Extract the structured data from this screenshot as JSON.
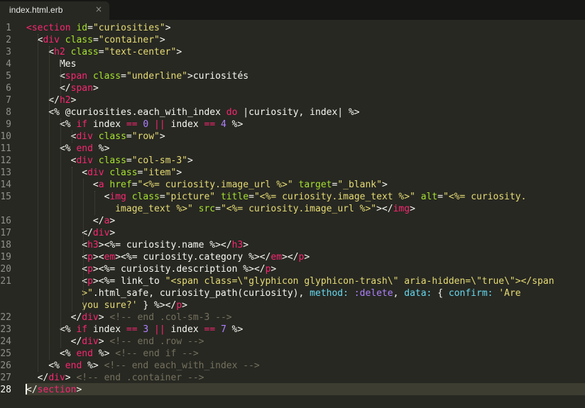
{
  "tab": {
    "title": "index.html.erb",
    "close_glyph": "×"
  },
  "editor": {
    "current_line": 28,
    "line_numbers": [
      "1",
      "2",
      "3",
      "4",
      "5",
      "6",
      "7",
      "8",
      "9",
      "10",
      "11",
      "12",
      "13",
      "14",
      "15",
      "",
      "16",
      "17",
      "18",
      "19",
      "20",
      "21",
      "",
      "",
      "22",
      "23",
      "24",
      "25",
      "26",
      "27",
      "28"
    ],
    "lines": [
      [
        [
          "t",
          "<"
        ],
        [
          "t",
          "section"
        ],
        [
          "w",
          " "
        ],
        [
          "a",
          "id"
        ],
        [
          "w",
          "="
        ],
        [
          "s",
          "\"curiosities\""
        ],
        [
          "w",
          ">"
        ]
      ],
      [
        [
          "w",
          "  <"
        ],
        [
          "t",
          "div"
        ],
        [
          "w",
          " "
        ],
        [
          "a",
          "class"
        ],
        [
          "w",
          "="
        ],
        [
          "s",
          "\"container\""
        ],
        [
          "w",
          ">"
        ]
      ],
      [
        [
          "w",
          "    <"
        ],
        [
          "t",
          "h2"
        ],
        [
          "w",
          " "
        ],
        [
          "a",
          "class"
        ],
        [
          "w",
          "="
        ],
        [
          "s",
          "\"text-center\""
        ],
        [
          "w",
          ">"
        ]
      ],
      [
        [
          "w",
          "      Mes"
        ]
      ],
      [
        [
          "w",
          "      <"
        ],
        [
          "t",
          "span"
        ],
        [
          "w",
          " "
        ],
        [
          "a",
          "class"
        ],
        [
          "w",
          "="
        ],
        [
          "s",
          "\"underline\""
        ],
        [
          "w",
          ">curiosités"
        ]
      ],
      [
        [
          "w",
          "      </"
        ],
        [
          "t",
          "span"
        ],
        [
          "w",
          ">"
        ]
      ],
      [
        [
          "w",
          "    </"
        ],
        [
          "t",
          "h2"
        ],
        [
          "w",
          ">"
        ]
      ],
      [
        [
          "w",
          "    <% @curiosities.each_with_index "
        ],
        [
          "t",
          "do"
        ],
        [
          "w",
          " |curiosity, index| %>"
        ]
      ],
      [
        [
          "w",
          "      <% "
        ],
        [
          "t",
          "if"
        ],
        [
          "w",
          " index "
        ],
        [
          "t",
          "=="
        ],
        [
          "w",
          " "
        ],
        [
          "n",
          "0"
        ],
        [
          "w",
          " "
        ],
        [
          "t",
          "||"
        ],
        [
          "w",
          " index "
        ],
        [
          "t",
          "=="
        ],
        [
          "w",
          " "
        ],
        [
          "n",
          "4"
        ],
        [
          "w",
          " %>"
        ]
      ],
      [
        [
          "w",
          "        <"
        ],
        [
          "t",
          "div"
        ],
        [
          "w",
          " "
        ],
        [
          "a",
          "class"
        ],
        [
          "w",
          "="
        ],
        [
          "s",
          "\"row\""
        ],
        [
          "w",
          ">"
        ]
      ],
      [
        [
          "w",
          "      <% "
        ],
        [
          "t",
          "end"
        ],
        [
          "w",
          " %>"
        ]
      ],
      [
        [
          "w",
          "        <"
        ],
        [
          "t",
          "div"
        ],
        [
          "w",
          " "
        ],
        [
          "a",
          "class"
        ],
        [
          "w",
          "="
        ],
        [
          "s",
          "\"col-sm-3\""
        ],
        [
          "w",
          ">"
        ]
      ],
      [
        [
          "w",
          "          <"
        ],
        [
          "t",
          "div"
        ],
        [
          "w",
          " "
        ],
        [
          "a",
          "class"
        ],
        [
          "w",
          "="
        ],
        [
          "s",
          "\"item\""
        ],
        [
          "w",
          ">"
        ]
      ],
      [
        [
          "w",
          "            <"
        ],
        [
          "t",
          "a"
        ],
        [
          "w",
          " "
        ],
        [
          "a",
          "href"
        ],
        [
          "w",
          "="
        ],
        [
          "s",
          "\"<%= curiosity.image_url %>\""
        ],
        [
          "w",
          " "
        ],
        [
          "a",
          "target"
        ],
        [
          "w",
          "="
        ],
        [
          "s",
          "\"_blank\""
        ],
        [
          "w",
          ">"
        ]
      ],
      [
        [
          "w",
          "              <"
        ],
        [
          "t",
          "img"
        ],
        [
          "w",
          " "
        ],
        [
          "a",
          "class"
        ],
        [
          "w",
          "="
        ],
        [
          "s",
          "\"picture\""
        ],
        [
          "w",
          " "
        ],
        [
          "a",
          "title"
        ],
        [
          "w",
          "="
        ],
        [
          "s",
          "\"<%= curiosity.image_text %>\""
        ],
        [
          "w",
          " "
        ],
        [
          "a",
          "alt"
        ],
        [
          "w",
          "="
        ],
        [
          "s",
          "\"<%= curiosity."
        ]
      ],
      [
        [
          "s",
          "                image_text %>\""
        ],
        [
          "w",
          " "
        ],
        [
          "a",
          "src"
        ],
        [
          "w",
          "="
        ],
        [
          "s",
          "\"<%= curiosity.image_url %>\""
        ],
        [
          "w",
          "></"
        ],
        [
          "t",
          "img"
        ],
        [
          "w",
          ">"
        ]
      ],
      [
        [
          "w",
          "            </"
        ],
        [
          "t",
          "a"
        ],
        [
          "w",
          ">"
        ]
      ],
      [
        [
          "w",
          "          </"
        ],
        [
          "t",
          "div"
        ],
        [
          "w",
          ">"
        ]
      ],
      [
        [
          "w",
          "          <"
        ],
        [
          "t",
          "h3"
        ],
        [
          "w",
          "><%= curiosity.name %></"
        ],
        [
          "t",
          "h3"
        ],
        [
          "w",
          ">"
        ]
      ],
      [
        [
          "w",
          "          <"
        ],
        [
          "t",
          "p"
        ],
        [
          "w",
          "><"
        ],
        [
          "t",
          "em"
        ],
        [
          "w",
          "><%= curiosity.category %></"
        ],
        [
          "t",
          "em"
        ],
        [
          "w",
          "></"
        ],
        [
          "t",
          "p"
        ],
        [
          "w",
          ">"
        ]
      ],
      [
        [
          "w",
          "          <"
        ],
        [
          "t",
          "p"
        ],
        [
          "w",
          "><%= curiosity.description %></"
        ],
        [
          "t",
          "p"
        ],
        [
          "w",
          ">"
        ]
      ],
      [
        [
          "w",
          "          <"
        ],
        [
          "t",
          "p"
        ],
        [
          "w",
          "><%= link_to "
        ],
        [
          "s",
          "\"<span class=\\\"glyphicon glyphicon-trash\\\" aria-hidden=\\\"true\\\"></span"
        ]
      ],
      [
        [
          "s",
          "          >\""
        ],
        [
          "w",
          ".html_safe, curiosity_path(curiosity), "
        ],
        [
          "k",
          "method:"
        ],
        [
          "w",
          " "
        ],
        [
          "sym",
          ":delete"
        ],
        [
          "w",
          ", "
        ],
        [
          "k",
          "data:"
        ],
        [
          "w",
          " { "
        ],
        [
          "k",
          "confirm:"
        ],
        [
          "w",
          " "
        ],
        [
          "s",
          "'Are"
        ]
      ],
      [
        [
          "s",
          "          you sure?'"
        ],
        [
          "w",
          " } %></"
        ],
        [
          "t",
          "p"
        ],
        [
          "w",
          ">"
        ]
      ],
      [
        [
          "w",
          "        </"
        ],
        [
          "t",
          "div"
        ],
        [
          "w",
          "> "
        ],
        [
          "c",
          "<!-- end .col-sm-3 -->"
        ]
      ],
      [
        [
          "w",
          "      <% "
        ],
        [
          "t",
          "if"
        ],
        [
          "w",
          " index "
        ],
        [
          "t",
          "=="
        ],
        [
          "w",
          " "
        ],
        [
          "n",
          "3"
        ],
        [
          "w",
          " "
        ],
        [
          "t",
          "||"
        ],
        [
          "w",
          " index "
        ],
        [
          "t",
          "=="
        ],
        [
          "w",
          " "
        ],
        [
          "n",
          "7"
        ],
        [
          "w",
          " %>"
        ]
      ],
      [
        [
          "w",
          "        </"
        ],
        [
          "t",
          "div"
        ],
        [
          "w",
          "> "
        ],
        [
          "c",
          "<!-- end .row -->"
        ]
      ],
      [
        [
          "w",
          "      <% "
        ],
        [
          "t",
          "end"
        ],
        [
          "w",
          " %> "
        ],
        [
          "c",
          "<!-- end if -->"
        ]
      ],
      [
        [
          "w",
          "    <% "
        ],
        [
          "t",
          "end"
        ],
        [
          "w",
          " %> "
        ],
        [
          "c",
          "<!-- end each_with_index -->"
        ]
      ],
      [
        [
          "w",
          "  </"
        ],
        [
          "t",
          "div"
        ],
        [
          "w",
          "> "
        ],
        [
          "c",
          "<!-- end .container -->"
        ]
      ],
      [
        [
          "w",
          "</"
        ],
        [
          "t",
          "section"
        ],
        [
          "w",
          ">"
        ]
      ]
    ]
  },
  "colors": {
    "background": "#272822",
    "tag": "#f92672",
    "attribute": "#a6e22e",
    "string": "#e6db74",
    "number": "#ae81ff",
    "comment": "#75715e"
  }
}
